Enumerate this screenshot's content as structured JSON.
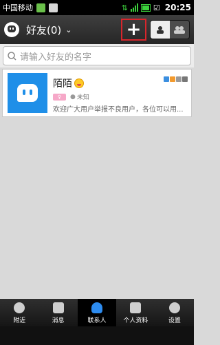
{
  "status_bar": {
    "carrier": "中国移动",
    "time": "20:25",
    "colors": {
      "signal": "#3cd13c",
      "battery": "#3cd13c"
    }
  },
  "header": {
    "title": "好友(0)",
    "add_icon": "plus-icon",
    "toggle": [
      "single-contact-icon",
      "group-contacts-icon"
    ]
  },
  "search": {
    "placeholder": "请输入好友的名字",
    "icon": "search-icon"
  },
  "contact": {
    "name": "陌陌",
    "location": "未知",
    "signature": "欢迎广大用户举报不良用户，各位可以用...",
    "gender_tag_color": "#f6a8c8",
    "avatar_color": "#1f8fe8"
  },
  "tabs": [
    {
      "label": "附近",
      "icon": "nearby-icon",
      "active": false
    },
    {
      "label": "消息",
      "icon": "message-icon",
      "active": false
    },
    {
      "label": "联系人",
      "icon": "contacts-icon",
      "active": true
    },
    {
      "label": "个人资料",
      "icon": "profile-icon",
      "active": false
    },
    {
      "label": "设置",
      "icon": "settings-icon",
      "active": false
    }
  ],
  "colors": {
    "highlight": "#d8262c",
    "active_tab": "#2d8cf0"
  }
}
